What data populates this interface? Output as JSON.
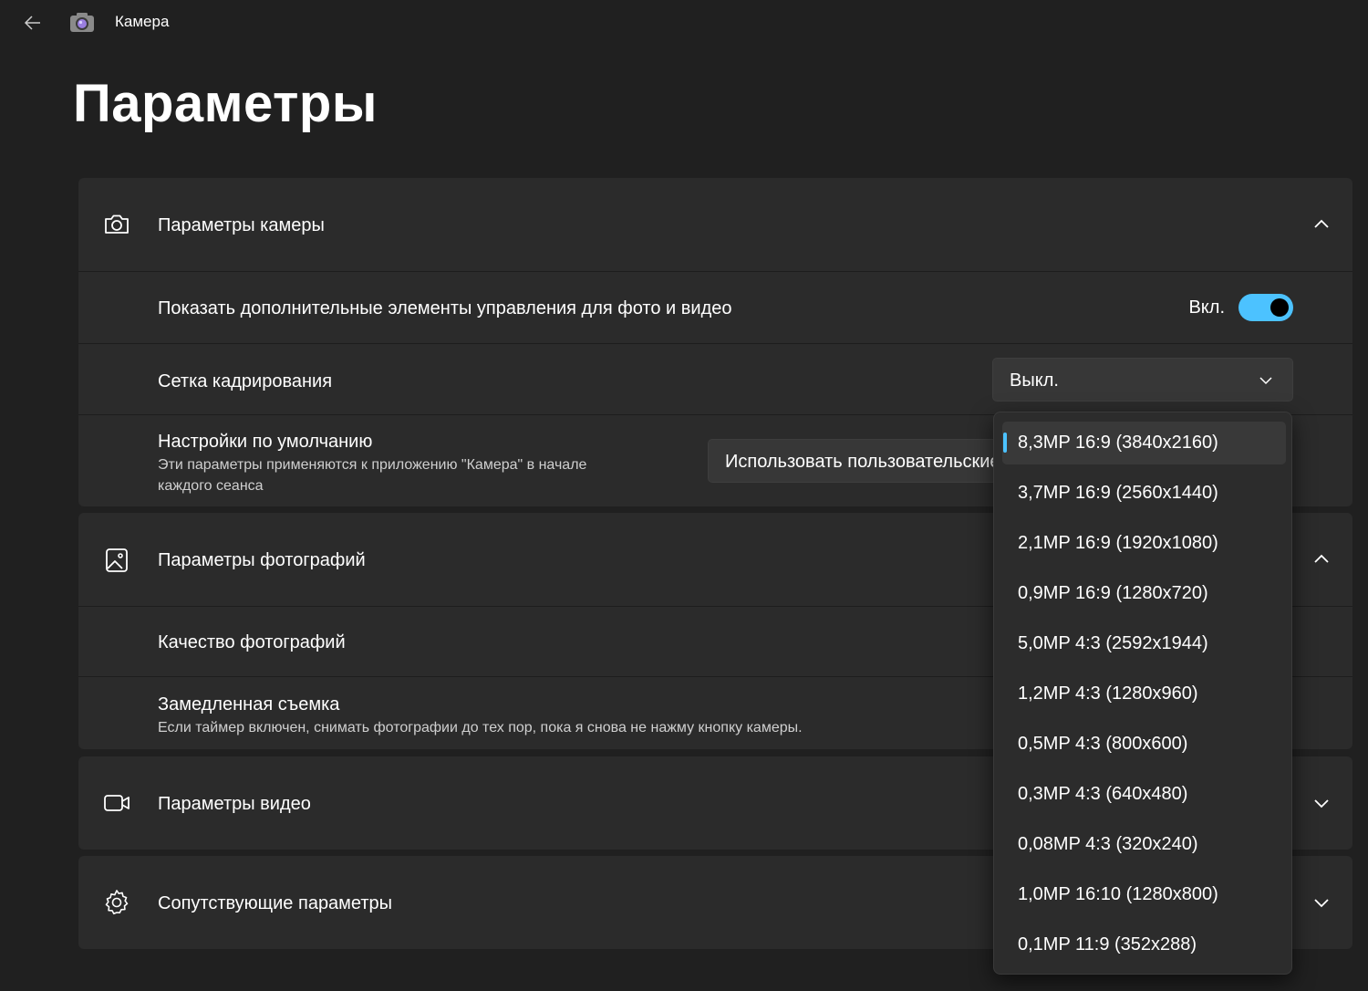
{
  "app": {
    "title": "Камера"
  },
  "page": {
    "title": "Параметры"
  },
  "camera_section": {
    "title": "Параметры камеры",
    "extra_controls": {
      "label": "Показать дополнительные элементы управления для фото и видео",
      "state_text": "Вкл.",
      "on": true
    },
    "crop_grid": {
      "label": "Сетка кадрирования",
      "value": "Выкл."
    },
    "defaults": {
      "label": "Настройки по умолчанию",
      "description_line1": "Эти параметры применяются к приложению \"Камера\" в начале",
      "description_line2": "каждого сеанса",
      "value": "Использовать пользовательские"
    }
  },
  "photo_section": {
    "title": "Параметры фотографий",
    "quality": {
      "label": "Качество фотографий"
    },
    "burst": {
      "label": "Замедленная съемка",
      "description": "Если таймер включен, снимать фотографии до тех пор, пока я снова не нажму кнопку камеры."
    }
  },
  "video_section": {
    "title": "Параметры видео"
  },
  "related_section": {
    "title": "Сопутствующие параметры"
  },
  "resolution_dropdown": {
    "selected_index": 0,
    "items": [
      "8,3MP 16:9 (3840x2160)",
      "3,7MP 16:9 (2560x1440)",
      "2,1MP 16:9 (1920x1080)",
      "0,9MP 16:9 (1280x720)",
      "5,0MP 4:3 (2592x1944)",
      "1,2MP 4:3 (1280x960)",
      "0,5MP 4:3 (800x600)",
      "0,3MP 4:3 (640x480)",
      "0,08MP 4:3 (320x240)",
      "1,0MP 16:10 (1280x800)",
      "0,1MP 11:9 (352x288)"
    ]
  },
  "colors": {
    "accent": "#4cc2ff",
    "background": "#202020",
    "card": "#2b2b2b"
  }
}
